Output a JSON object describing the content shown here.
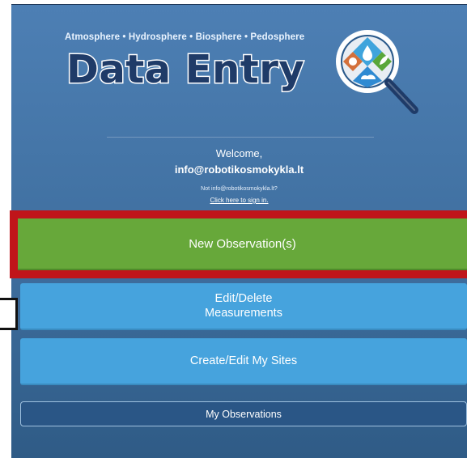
{
  "header": {
    "tagline": "Atmosphere • Hydrosphere • Biosphere • Pedosphere",
    "title": "Data Entry",
    "logo_icon": "magnifier-globe-icon"
  },
  "account": {
    "welcome": "Welcome,",
    "email": "info@robotikosmokykla.lt",
    "not_user": "Not info@robotikosmokykla.lt?",
    "sign_in_link": "Click here to sign in."
  },
  "actions": {
    "new_observation": "New Observation(s)",
    "edit_delete_line1": "Edit/Delete",
    "edit_delete_line2": "Measurements",
    "create_edit_sites": "Create/Edit My Sites",
    "my_observations": "My Observations"
  },
  "colors": {
    "background": "#3f6f9f",
    "title_fill": "#1f3b68",
    "green_button": "#67a83a",
    "blue_button": "#46a3dd",
    "highlight": "#c0151a"
  }
}
